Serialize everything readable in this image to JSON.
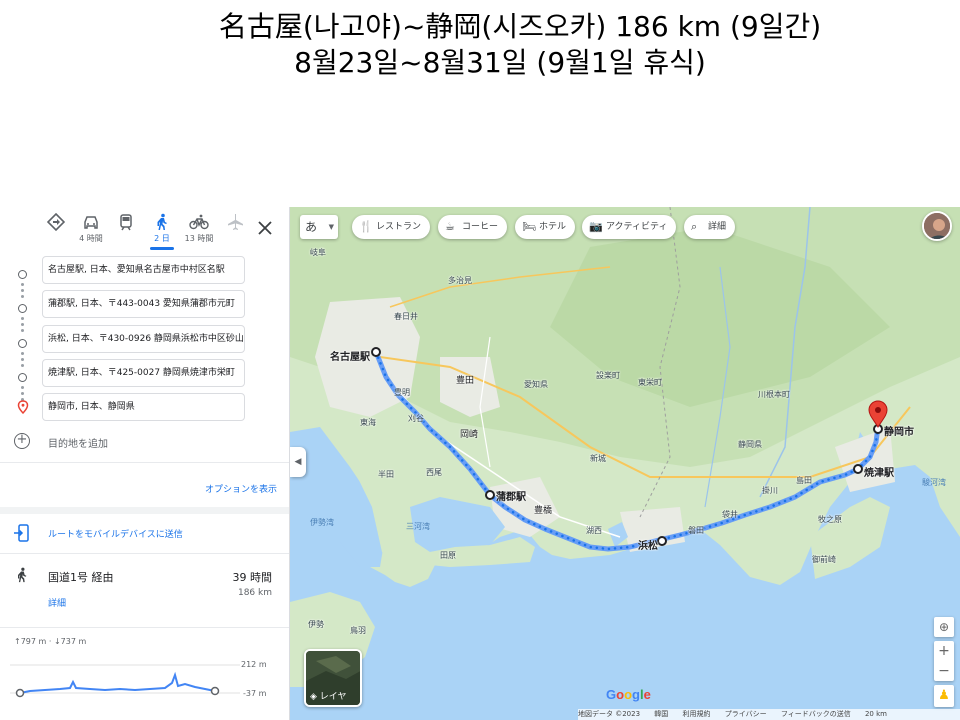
{
  "slide": {
    "title_line1": "名古屋(나고야)~静岡(시즈오카) 186 km (9일간)",
    "title_line2": "8월23일~8월31일 (9월1일 휴식)"
  },
  "modes": [
    {
      "name": "best",
      "sub": ""
    },
    {
      "name": "car",
      "sub": "4 時間"
    },
    {
      "name": "transit",
      "sub": ""
    },
    {
      "name": "walk",
      "sub": "2 日"
    },
    {
      "name": "bike",
      "sub": "13 時間"
    },
    {
      "name": "flight",
      "sub": ""
    }
  ],
  "stops": [
    "名古屋駅, 日本、愛知県名古屋市中村区名駅",
    "蒲郡駅, 日本、〒443-0043 愛知県蒲郡市元町",
    "浜松, 日本、〒430-0926 静岡県浜松市中区砂山町",
    "焼津駅, 日本、〒425-0027 静岡県焼津市栄町",
    "静岡市, 日本、静岡県"
  ],
  "add_destination": "目的地を追加",
  "options_link": "オプションを表示",
  "send_to_device": "ルートをモバイルデバイスに送信",
  "route": {
    "via": "国道1号 経由",
    "time": "39 時間",
    "distance": "186 km",
    "details": "詳細"
  },
  "elevation": {
    "stats": "↑797 m · ↓737 m",
    "max": "212 m",
    "min": "-37 m"
  },
  "map": {
    "ime_label": "あ",
    "chips": [
      "レストラン",
      "コーヒー",
      "ホテル",
      "アクティビティ",
      "詳細"
    ],
    "labels": {
      "nagoya_station": "名古屋駅",
      "gamagori_station": "蒲郡駅",
      "hamamatsu": "浜松",
      "yaizu_station": "焼津駅",
      "shizuoka_city": "静岡市",
      "toyota": "豊田",
      "aichi": "愛知県",
      "shizuoka_pref": "静岡県",
      "okazaki": "岡崎",
      "toyohashi": "豊橋",
      "kasugai": "春日井",
      "tajimi": "多治見",
      "kakegawa": "掛川",
      "iwata": "磐田",
      "fukuroi": "袋井",
      "shimada": "島田",
      "makinohara": "牧之原",
      "omaezaki": "御前崎",
      "shinshiro": "新城",
      "toei": "東栄町",
      "shitara": "設楽町",
      "kawanehoncho": "川根本町",
      "kosai": "湖西",
      "tahara": "田原",
      "nishio": "西尾",
      "kariya": "刈谷",
      "tokai": "東海",
      "handa": "半田",
      "toyoake": "豊明",
      "ise_bay": "伊勢湾",
      "mikawa_bay": "三河湾",
      "suruga_bay": "駿河湾",
      "ise": "伊勢",
      "toba": "鳥羽",
      "gifu": "岐阜"
    },
    "layers_label": "レイヤ",
    "google_logo": "Google",
    "footer": [
      "地図データ ©2023",
      "韓国",
      "利用規約",
      "プライバシー",
      "フィードバックの送信",
      "20 km"
    ]
  },
  "colors": {
    "accent": "#1a73e8",
    "route": "#4285f4",
    "route_dots": "#1a73e8",
    "destination_pin": "#ea4335",
    "land": "#d9ead3",
    "water": "#aad3f6"
  }
}
